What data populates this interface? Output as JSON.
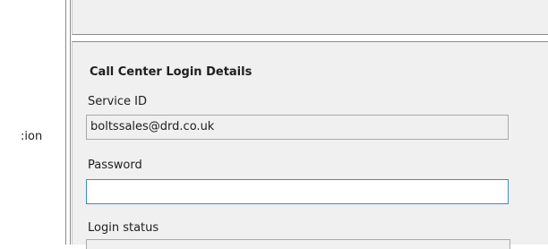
{
  "left_panel": {
    "label_fragment": ":ion"
  },
  "call_center": {
    "section_title": "Call Center Login Details",
    "service_id": {
      "label": "Service ID",
      "value": "boltssales@drd.co.uk"
    },
    "password": {
      "label": "Password",
      "value": ""
    },
    "login_status": {
      "label": "Login status"
    }
  }
}
